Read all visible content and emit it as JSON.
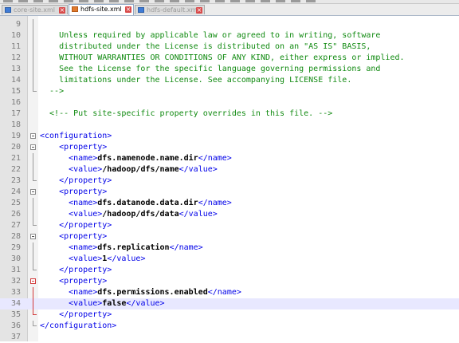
{
  "toolbar": {
    "icons": [
      "new-icon",
      "open-icon",
      "save-icon",
      "save-all-icon",
      "close-icon",
      "close-all-icon",
      "print-icon",
      "cut-icon",
      "copy-icon",
      "paste-icon",
      "undo-icon",
      "redo-icon",
      "find-icon",
      "replace-icon",
      "zoom-in-icon",
      "zoom-out-icon",
      "sync-icon",
      "wrap-icon",
      "indent-icon",
      "show-all-icon",
      "macro-icon"
    ]
  },
  "tabs": [
    {
      "label": "core-site.xml",
      "state": "faded"
    },
    {
      "label": "hdfs-site.xml",
      "state": "active"
    },
    {
      "label": "hdfs-default.xml",
      "state": "faded"
    }
  ],
  "editor": {
    "current_line": 34,
    "lines": [
      {
        "n": "9",
        "fold": "vline",
        "seg": []
      },
      {
        "n": "10",
        "fold": "vline",
        "seg": [
          [
            "comment",
            "    Unless required by applicable law or agreed to in writing, software"
          ]
        ]
      },
      {
        "n": "11",
        "fold": "vline",
        "seg": [
          [
            "comment",
            "    distributed under the License is distributed on an \"AS IS\" BASIS,"
          ]
        ]
      },
      {
        "n": "12",
        "fold": "vline",
        "seg": [
          [
            "comment",
            "    WITHOUT WARRANTIES OR CONDITIONS OF ANY KIND, either express or implied."
          ]
        ]
      },
      {
        "n": "13",
        "fold": "vline",
        "seg": [
          [
            "comment",
            "    See the License for the specific language governing permissions and"
          ]
        ]
      },
      {
        "n": "14",
        "fold": "vline",
        "seg": [
          [
            "comment",
            "    limitations under the License. See accompanying LICENSE file."
          ]
        ]
      },
      {
        "n": "15",
        "fold": "end",
        "seg": [
          [
            "comment",
            "  -->"
          ]
        ]
      },
      {
        "n": "16",
        "fold": "",
        "seg": []
      },
      {
        "n": "17",
        "fold": "",
        "seg": [
          [
            "comment",
            "  <!-- Put site-specific property overrides in this file. -->"
          ]
        ]
      },
      {
        "n": "18",
        "fold": "",
        "seg": []
      },
      {
        "n": "19",
        "fold": "box",
        "seg": [
          [
            "tag",
            "<configuration>"
          ]
        ]
      },
      {
        "n": "20",
        "fold": "box",
        "seg": [
          [
            "tag",
            "    <property>"
          ]
        ]
      },
      {
        "n": "21",
        "fold": "vline",
        "seg": [
          [
            "tag",
            "      <name>"
          ],
          [
            "val",
            "dfs.namenode.name.dir"
          ],
          [
            "tag",
            "</name>"
          ]
        ]
      },
      {
        "n": "22",
        "fold": "vline",
        "seg": [
          [
            "tag",
            "      <value>"
          ],
          [
            "val",
            "/hadoop/dfs/name"
          ],
          [
            "tag",
            "</value>"
          ]
        ]
      },
      {
        "n": "23",
        "fold": "end",
        "seg": [
          [
            "tag",
            "    </property>"
          ]
        ]
      },
      {
        "n": "24",
        "fold": "box",
        "seg": [
          [
            "tag",
            "    <property>"
          ]
        ]
      },
      {
        "n": "25",
        "fold": "vline",
        "seg": [
          [
            "tag",
            "      <name>"
          ],
          [
            "val",
            "dfs.datanode.data.dir"
          ],
          [
            "tag",
            "</name>"
          ]
        ]
      },
      {
        "n": "26",
        "fold": "vline",
        "seg": [
          [
            "tag",
            "      <value>"
          ],
          [
            "val",
            "/hadoop/dfs/data"
          ],
          [
            "tag",
            "</value>"
          ]
        ]
      },
      {
        "n": "27",
        "fold": "end",
        "seg": [
          [
            "tag",
            "    </property>"
          ]
        ]
      },
      {
        "n": "28",
        "fold": "box",
        "seg": [
          [
            "tag",
            "    <property>"
          ]
        ]
      },
      {
        "n": "29",
        "fold": "vline",
        "seg": [
          [
            "tag",
            "      <name>"
          ],
          [
            "val",
            "dfs.replication"
          ],
          [
            "tag",
            "</name>"
          ]
        ]
      },
      {
        "n": "30",
        "fold": "vline",
        "seg": [
          [
            "tag",
            "      <value>"
          ],
          [
            "val",
            "1"
          ],
          [
            "tag",
            "</value>"
          ]
        ]
      },
      {
        "n": "31",
        "fold": "end",
        "seg": [
          [
            "tag",
            "    </property>"
          ]
        ]
      },
      {
        "n": "32",
        "fold": "box-red",
        "seg": [
          [
            "tag",
            "    <property>"
          ]
        ]
      },
      {
        "n": "33",
        "fold": "vline-red",
        "seg": [
          [
            "tag",
            "      <name>"
          ],
          [
            "val",
            "dfs.permissions.enabled"
          ],
          [
            "tag",
            "</name>"
          ]
        ]
      },
      {
        "n": "34",
        "fold": "vline-red",
        "seg": [
          [
            "tag",
            "      <value>"
          ],
          [
            "val",
            "false"
          ],
          [
            "tag",
            "</value>"
          ]
        ]
      },
      {
        "n": "35",
        "fold": "end-red",
        "seg": [
          [
            "tag",
            "    </property>"
          ]
        ]
      },
      {
        "n": "36",
        "fold": "end",
        "seg": [
          [
            "tag",
            "</configuration>"
          ]
        ]
      },
      {
        "n": "37",
        "fold": "",
        "seg": []
      }
    ]
  }
}
